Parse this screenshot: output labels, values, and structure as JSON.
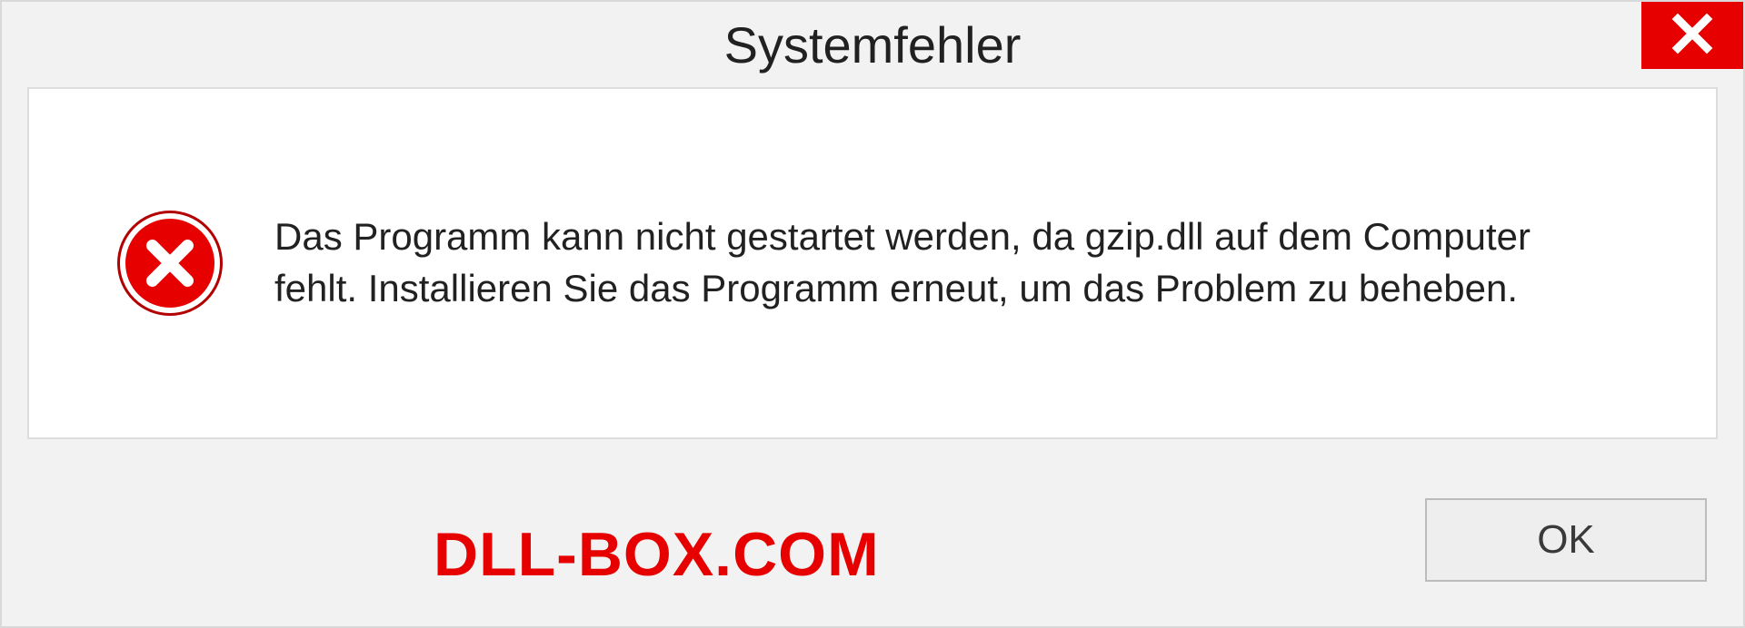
{
  "dialog": {
    "title": "Systemfehler",
    "message": "Das Programm kann nicht gestartet werden, da gzip.dll auf dem Computer fehlt. Installieren Sie das Programm erneut, um das Problem zu beheben.",
    "ok_label": "OK"
  },
  "watermark": {
    "text": "DLL-BOX.COM"
  },
  "colors": {
    "error_red": "#e60000",
    "background": "#f2f2f2",
    "panel_bg": "#ffffff",
    "border": "#dddddd"
  },
  "icons": {
    "close": "close-icon",
    "error": "error-circle-x-icon"
  }
}
